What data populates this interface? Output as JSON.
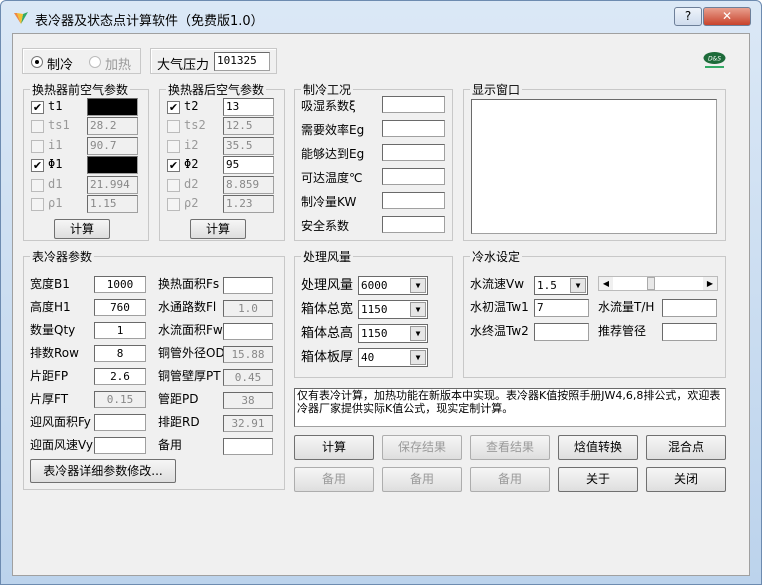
{
  "window": {
    "title": "表冷器及状态点计算软件（免费版1.0）",
    "help_label": "?",
    "close_label": "✕"
  },
  "mode": {
    "options": [
      {
        "label": "制冷",
        "selected": true,
        "enabled": true
      },
      {
        "label": "加热",
        "selected": false,
        "enabled": false
      }
    ]
  },
  "pressure": {
    "label": "大气压力",
    "value": "101325"
  },
  "logo": {
    "text": "D&S"
  },
  "inlet_air": {
    "title": "换热器前空气参数",
    "rows": [
      {
        "label": "t1",
        "checked": true,
        "enabled": true,
        "value": "",
        "black": true
      },
      {
        "label": "ts1",
        "checked": false,
        "enabled": false,
        "value": "28.2"
      },
      {
        "label": "i1",
        "checked": false,
        "enabled": false,
        "value": "90.7"
      },
      {
        "label": "Φ1",
        "checked": true,
        "enabled": true,
        "value": "",
        "black": true
      },
      {
        "label": "d1",
        "checked": false,
        "enabled": false,
        "value": "21.994"
      },
      {
        "label": "ρ1",
        "checked": false,
        "enabled": false,
        "value": "1.15"
      }
    ],
    "calc_label": "计算"
  },
  "outlet_air": {
    "title": "换热器后空气参数",
    "rows": [
      {
        "label": "t2",
        "checked": true,
        "enabled": true,
        "value": "13"
      },
      {
        "label": "ts2",
        "checked": false,
        "enabled": false,
        "value": "12.5"
      },
      {
        "label": "i2",
        "checked": false,
        "enabled": false,
        "value": "35.5"
      },
      {
        "label": "Φ2",
        "checked": true,
        "enabled": true,
        "value": "95"
      },
      {
        "label": "d2",
        "checked": false,
        "enabled": false,
        "value": "8.859"
      },
      {
        "label": "ρ2",
        "checked": false,
        "enabled": false,
        "value": "1.23"
      }
    ],
    "calc_label": "计算"
  },
  "cooling": {
    "title": "制冷工况",
    "rows": [
      {
        "label": "吸湿系数ξ",
        "value": ""
      },
      {
        "label": "需要效率Eg",
        "value": ""
      },
      {
        "label": "能够达到Eg",
        "value": ""
      },
      {
        "label": "可达温度℃",
        "value": ""
      },
      {
        "label": "制冷量KW",
        "value": ""
      },
      {
        "label": "安全系数",
        "value": ""
      }
    ]
  },
  "display": {
    "title": "显示窗口",
    "content": ""
  },
  "coil": {
    "title": "表冷器参数",
    "left": [
      {
        "label": "宽度B1",
        "value": "1000",
        "enabled": true
      },
      {
        "label": "高度H1",
        "value": "760",
        "enabled": true
      },
      {
        "label": "数量Qty",
        "value": "1",
        "enabled": true
      },
      {
        "label": "排数Row",
        "value": "8",
        "enabled": true
      },
      {
        "label": "片距FP",
        "value": "2.6",
        "enabled": true
      },
      {
        "label": "片厚FT",
        "value": "0.15",
        "enabled": false
      },
      {
        "label": "迎风面积Fy",
        "value": "",
        "enabled": true
      },
      {
        "label": "迎面风速Vy",
        "value": "",
        "enabled": true
      }
    ],
    "right": [
      {
        "label": "换热面积Fs",
        "value": "",
        "enabled": true
      },
      {
        "label": "水通路数Fl",
        "value": "1.0",
        "enabled": false
      },
      {
        "label": "水流面积Fw",
        "value": "",
        "enabled": true
      },
      {
        "label": "铜管外径OD",
        "value": "15.88",
        "enabled": false
      },
      {
        "label": "铜管壁厚PT",
        "value": "0.45",
        "enabled": false
      },
      {
        "label": "管距PD",
        "value": "38",
        "enabled": false
      },
      {
        "label": "排距RD",
        "value": "32.91",
        "enabled": false
      },
      {
        "label": "备用",
        "value": "",
        "enabled": true
      }
    ],
    "detail_button": "表冷器详细参数修改..."
  },
  "airflow": {
    "title": "处理风量",
    "rows": [
      {
        "label": "处理风量",
        "value": "6000"
      },
      {
        "label": "箱体总宽",
        "value": "1150"
      },
      {
        "label": "箱体总高",
        "value": "1150"
      },
      {
        "label": "箱体板厚",
        "value": "40"
      }
    ]
  },
  "water": {
    "title": "冷水设定",
    "velocity_label": "水流速Vw",
    "velocity_value": "1.5",
    "slider_level": 0.5,
    "tw1_label": "水初温Tw1",
    "tw1_value": "7",
    "flow_label": "水流量T/H",
    "flow_value": "",
    "tw2_label": "水终温Tw2",
    "tw2_value": "",
    "pipe_label": "推荐管径",
    "pipe_value": ""
  },
  "message": "仅有表冷计算，加热功能在新版本中实现。表冷器K值按照手册JW4,6,8排公式，欢迎表冷器厂家提供实际K值公式，现实定制计算。",
  "buttons": [
    [
      {
        "label": "计算",
        "enabled": true
      },
      {
        "label": "保存结果",
        "enabled": false
      },
      {
        "label": "查看结果",
        "enabled": false
      },
      {
        "label": "焓值转换",
        "enabled": true
      },
      {
        "label": "混合点",
        "enabled": true
      }
    ],
    [
      {
        "label": "备用",
        "enabled": false
      },
      {
        "label": "备用",
        "enabled": false
      },
      {
        "label": "备用",
        "enabled": false
      },
      {
        "label": "关于",
        "enabled": true
      },
      {
        "label": "关闭",
        "enabled": true
      }
    ]
  ]
}
